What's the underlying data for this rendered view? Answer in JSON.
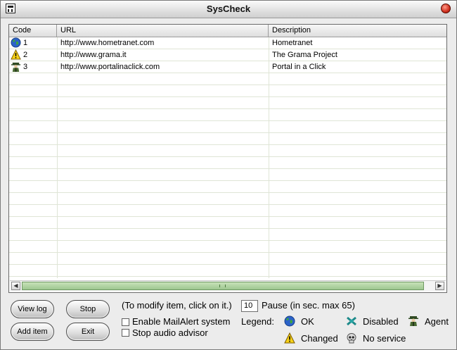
{
  "window": {
    "title": "SysCheck"
  },
  "list": {
    "columns": [
      "Code",
      "URL",
      "Description"
    ],
    "rows": [
      {
        "icon": "ok-globe-icon",
        "code": "1",
        "url": "http://www.hometranet.com",
        "description": "Hometranet"
      },
      {
        "icon": "changed-warning-icon",
        "code": "2",
        "url": "http://www.grama.it",
        "description": "The Grama Project"
      },
      {
        "icon": "agent-icon",
        "code": "3",
        "url": "http://www.portalinaclick.com",
        "description": "Portal in a Click"
      }
    ]
  },
  "buttons": {
    "view_log": "View log",
    "stop": "Stop",
    "add_item": "Add item",
    "exit": "Exit"
  },
  "hint": "(To modify item, click on it.)",
  "options": {
    "mailalert": {
      "label": "Enable MailAlert system",
      "checked": false
    },
    "audio": {
      "label": "Stop audio advisor",
      "checked": false
    }
  },
  "pause": {
    "value": "10",
    "label": "Pause (in sec. max 65)"
  },
  "legend": {
    "title": "Legend:",
    "items": [
      {
        "icon": "ok-globe-icon",
        "label": "OK"
      },
      {
        "icon": "disabled-icon",
        "label": "Disabled"
      },
      {
        "icon": "agent-icon",
        "label": "Agent"
      },
      {
        "icon": "changed-warning-icon",
        "label": "Changed"
      },
      {
        "icon": "skull-icon",
        "label": "No service"
      }
    ]
  },
  "colors": {
    "scroll_thumb": "#a9d09a",
    "grid_line": "#dfe5d6"
  }
}
